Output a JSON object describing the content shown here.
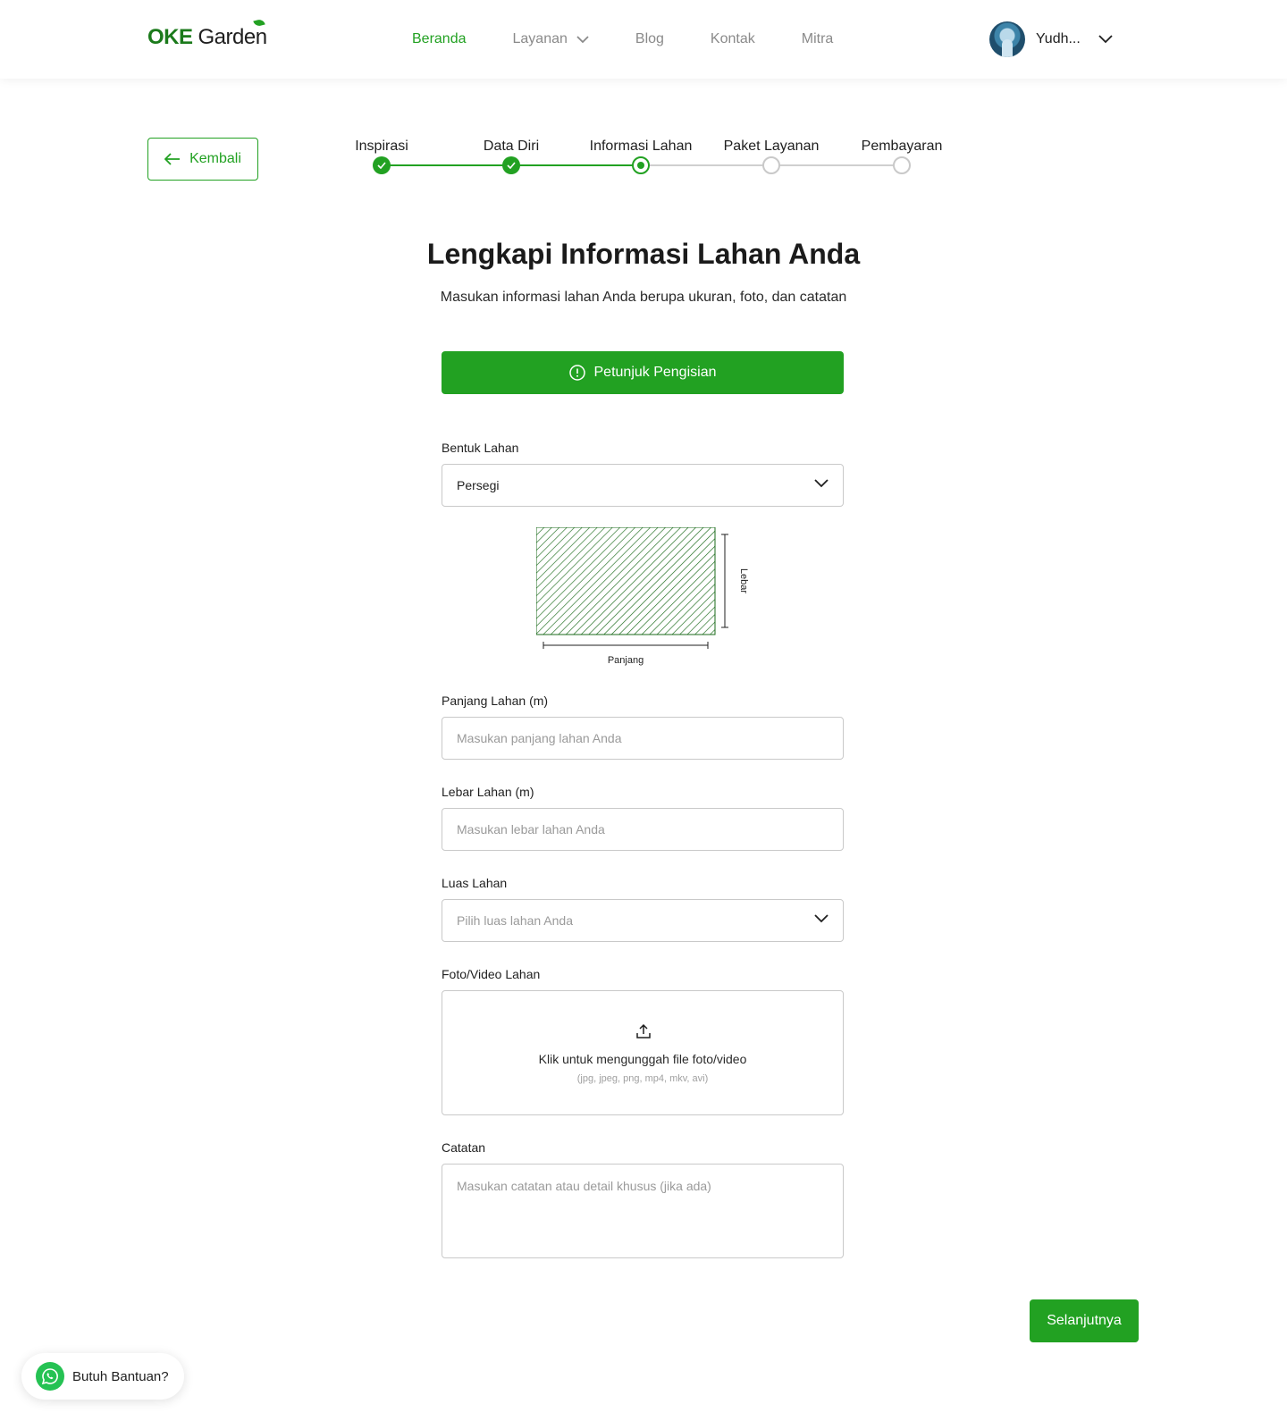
{
  "header": {
    "logo_main": "OKE",
    "logo_sub": "Garden",
    "nav": [
      {
        "label": "Beranda",
        "active": true
      },
      {
        "label": "Layanan",
        "dropdown": true
      },
      {
        "label": "Blog"
      },
      {
        "label": "Kontak"
      },
      {
        "label": "Mitra"
      }
    ],
    "profile_name": "Yudh..."
  },
  "back_label": "Kembali",
  "stepper": {
    "steps": [
      {
        "label": "Inspirasi",
        "state": "done"
      },
      {
        "label": "Data Diri",
        "state": "done"
      },
      {
        "label": "Informasi Lahan",
        "state": "current"
      },
      {
        "label": "Paket Layanan",
        "state": "todo"
      },
      {
        "label": "Pembayaran",
        "state": "todo"
      }
    ]
  },
  "main": {
    "title": "Lengkapi Informasi Lahan Anda",
    "subtitle": "Masukan informasi lahan Anda berupa ukuran, foto, dan catatan",
    "guide_label": "Petunjuk Pengisian"
  },
  "form": {
    "shape_label": "Bentuk Lahan",
    "shape_value": "Persegi",
    "diagram_length": "Panjang",
    "diagram_width": "Lebar",
    "length_label": "Panjang Lahan (m)",
    "length_placeholder": "Masukan panjang lahan Anda",
    "width_label": "Lebar Lahan (m)",
    "width_placeholder": "Masukan lebar lahan Anda",
    "area_label": "Luas Lahan",
    "area_placeholder": "Pilih luas lahan Anda",
    "media_label": "Foto/Video Lahan",
    "upload_text": "Klik untuk mengunggah file foto/video",
    "upload_hint": "(jpg, jpeg, png, mp4, mkv, avi)",
    "notes_label": "Catatan",
    "notes_placeholder": "Masukan catatan atau detail khusus (jika ada)"
  },
  "next_label": "Selanjutnya",
  "help_label": "Butuh Bantuan?",
  "colors": {
    "accent": "#22a122",
    "border": "#c9c9c9",
    "muted": "#8a8a8a"
  }
}
